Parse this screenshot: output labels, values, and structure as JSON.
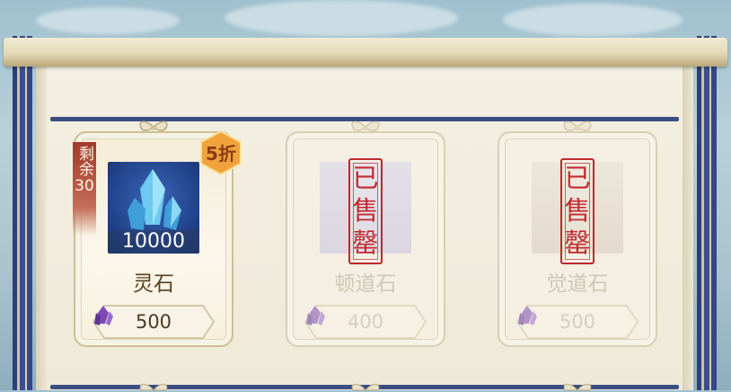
{
  "shop": {
    "items": [
      {
        "name": "灵石",
        "quantity": "10000",
        "price": "500",
        "currency_icon": "purple-crystal-icon",
        "stock_label": "剩余",
        "stock_count": "30",
        "discount": "5折",
        "status": "available"
      },
      {
        "name": "顿道石",
        "price": "400",
        "currency_icon": "purple-crystal-icon",
        "status": "sold_out",
        "sold_stamp": "已售罄"
      },
      {
        "name": "觉道石",
        "price": "500",
        "currency_icon": "purple-crystal-icon",
        "status": "sold_out",
        "sold_stamp": "已售罄"
      }
    ]
  },
  "colors": {
    "rail": "#3a4e84",
    "stamp": "#c0272d",
    "badge": "#f0a23c"
  }
}
